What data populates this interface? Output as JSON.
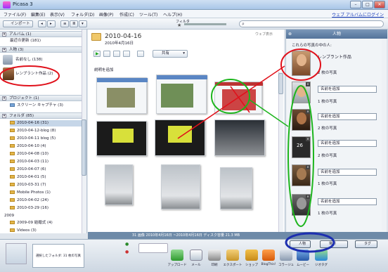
{
  "app": {
    "title": "Picasa 3"
  },
  "window_buttons": {
    "min": "–",
    "max": "□",
    "close": "✕"
  },
  "menu": {
    "items": [
      "ファイル(F)",
      "編集(E)",
      "表示(V)",
      "フォルダ(D)",
      "画像(P)",
      "作成(C)",
      "ツール(T)",
      "ヘルプ(H)"
    ],
    "web_album": "ウェブ アルバムにログイン"
  },
  "toolbar": {
    "import_label": "インポート",
    "filter_label": "フィルタ",
    "search_placeholder": ""
  },
  "left_panel": {
    "albums_header": "アルバム (1)",
    "albums": [
      {
        "label": "最近の更新 (181)"
      }
    ],
    "people_header": "人物 (3)",
    "people": [
      {
        "label": "名前なし (138)"
      },
      {
        "label": "レンブラント作品 (2)"
      }
    ],
    "projects_header": "プロジェクト (1)",
    "projects": [
      {
        "label": "スクリーン キャプチャ (3)"
      }
    ],
    "folders_header": "フォルダ (85)",
    "folders": [
      {
        "label": "2010-04-16 (31)",
        "selected": true
      },
      {
        "label": "2010-04-12-blog (8)"
      },
      {
        "label": "2010-04-11 blog (5)"
      },
      {
        "label": "2010-04-10 (4)"
      },
      {
        "label": "2010-04-08 (10)"
      },
      {
        "label": "2010-04-03 (11)"
      },
      {
        "label": "2010-04-07 (6)"
      },
      {
        "label": "2010-04-01 (5)"
      },
      {
        "label": "2010-03-31 (7)"
      },
      {
        "label": "Mobile Photos (1)"
      },
      {
        "label": "2010-04-02 (24)"
      },
      {
        "label": "2010-03-29 (16)"
      }
    ],
    "year_2009": "2009",
    "folders_2009": [
      {
        "label": "2009-09 結婚式 (4)"
      },
      {
        "label": "Videos (3)"
      }
    ]
  },
  "main": {
    "folder_title": "2010-04-16",
    "folder_date": "2010年4月16日",
    "quality_label": "ウェブ表示",
    "share_label": "共有",
    "add_caption": "説明を追加"
  },
  "status_bar": {
    "text": "31 画像   2010年4月16日 ~2010年4月16日  ディスク容量 21.3 MB"
  },
  "right_panel": {
    "title": "人物",
    "subtitle": "これらの写真の中の人:",
    "entries": [
      {
        "name": "レンブラント作品",
        "count": "2 枚の写真"
      },
      {
        "name": "",
        "count": "1 枚の写真",
        "placeholder": "名前を追加"
      },
      {
        "name": "",
        "count": "2 枚の写真",
        "placeholder": "名前を追加"
      },
      {
        "name": "",
        "count": "2 枚の写真",
        "placeholder": "名前を追加"
      },
      {
        "name": "",
        "count": "1 枚の写真",
        "placeholder": "名前を追加"
      },
      {
        "name": "",
        "count": "1 枚の写真",
        "placeholder": "名前を追加"
      }
    ],
    "highlighted_number": "26"
  },
  "bottom": {
    "tray_text": "選択したフォルダ: 31 枚の写真",
    "actions": [
      "アップロード",
      "メール",
      "印刷",
      "エクスポート",
      "ショップ",
      "BlogThis!",
      "コラージュ",
      "ムービー",
      "ジオタグ"
    ],
    "people_btn": "人物",
    "places_btn": "場所",
    "tags_btn": "タグ"
  }
}
